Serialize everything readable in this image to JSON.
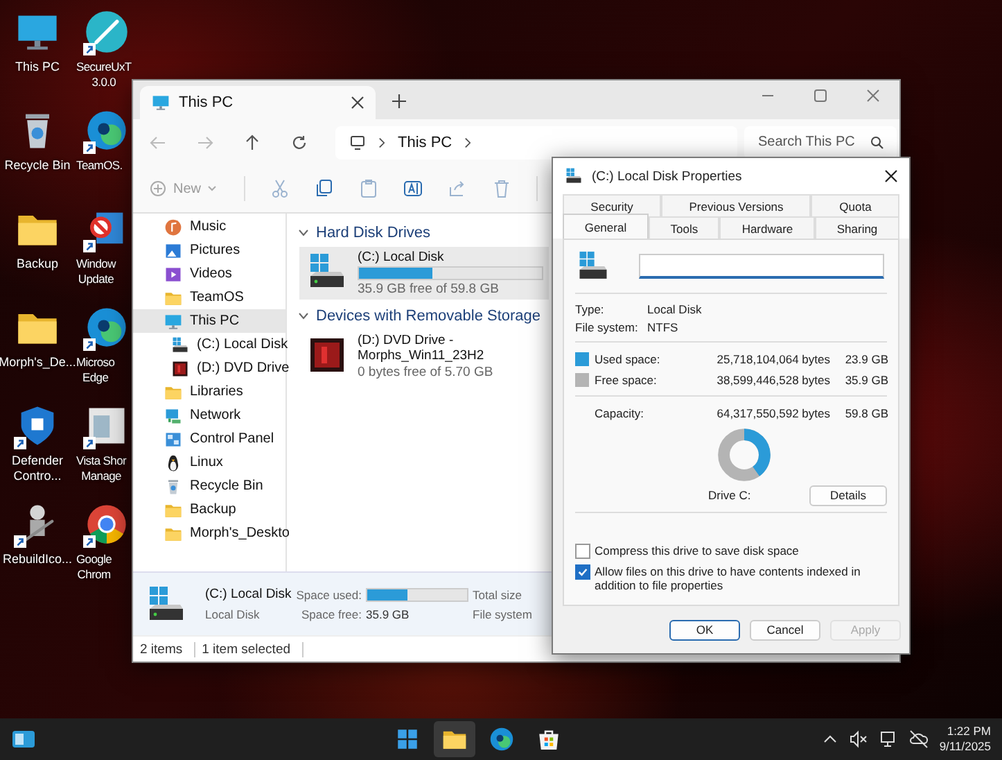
{
  "desktop": {
    "icons": [
      {
        "label": "This PC",
        "kind": "monitor",
        "shortcut": false
      },
      {
        "label": "SecureUxT\n3.0.0",
        "kind": "pen",
        "shortcut": true
      },
      {
        "label": "Recycle Bin",
        "kind": "bin",
        "shortcut": false
      },
      {
        "label": "TeamOS.",
        "kind": "edge",
        "shortcut": true
      },
      {
        "label": "Backup",
        "kind": "folder",
        "shortcut": false
      },
      {
        "label": "Window\nUpdate",
        "kind": "update",
        "shortcut": true
      },
      {
        "label": "Morph's_De...",
        "kind": "folder",
        "shortcut": false
      },
      {
        "label": "Microso\nEdge",
        "kind": "edge",
        "shortcut": true
      },
      {
        "label": "Defender\nContro...",
        "kind": "shield",
        "shortcut": true
      },
      {
        "label": "Vista Shor\nManage",
        "kind": "window",
        "shortcut": true
      },
      {
        "label": "RebuildIco...",
        "kind": "robot",
        "shortcut": true
      },
      {
        "label": "Google\nChrom",
        "kind": "chrome",
        "shortcut": true
      }
    ]
  },
  "explorer": {
    "tab": {
      "title": "This PC"
    },
    "address": {
      "path": "This PC"
    },
    "search": {
      "placeholder": "Search This PC"
    },
    "toolbar": {
      "new_label": "New"
    },
    "nav": [
      {
        "label": "Music",
        "kind": "music",
        "selected": false
      },
      {
        "label": "Pictures",
        "kind": "pictures",
        "selected": false
      },
      {
        "label": "Videos",
        "kind": "videos",
        "selected": false
      },
      {
        "label": "TeamOS",
        "kind": "folder",
        "selected": false
      },
      {
        "label": "This PC",
        "kind": "monitor",
        "selected": true,
        "children": [
          {
            "label": "(C:) Local Disk",
            "kind": "drive",
            "selected": false
          },
          {
            "label": "(D:) DVD Drive",
            "kind": "dvd",
            "selected": false
          }
        ]
      },
      {
        "label": "Libraries",
        "kind": "folder",
        "selected": false
      },
      {
        "label": "Network",
        "kind": "network",
        "selected": false
      },
      {
        "label": "Control Panel",
        "kind": "control",
        "selected": false
      },
      {
        "label": "Linux",
        "kind": "linux",
        "selected": false
      },
      {
        "label": "Recycle Bin",
        "kind": "bin",
        "selected": false
      },
      {
        "label": "Backup",
        "kind": "folder",
        "selected": false
      },
      {
        "label": "Morph's_Deskto",
        "kind": "folder",
        "selected": false
      }
    ],
    "groups": [
      {
        "title": "Hard Disk Drives",
        "drives": [
          {
            "name": "(C:) Local Disk",
            "kind": "hdd",
            "level": 0.4,
            "free": "35.9 GB free of 59.8 GB",
            "selected": true
          }
        ]
      },
      {
        "title": "Devices with Removable Storage",
        "drives": [
          {
            "name": "(D:) DVD Drive - Morphs_Win11_23H2",
            "kind": "dvd",
            "free": "0 bytes free of 5.70 GB",
            "selected": false
          }
        ]
      }
    ],
    "details": {
      "name": "(C:) Local Disk",
      "type": "Local Disk",
      "used_label": "Space used:",
      "level": 0.4,
      "free_label": "Space free:",
      "free": "35.9 GB",
      "total_label": "Total size",
      "fs_label": "File system"
    },
    "status": [
      "2 items",
      "1 item selected"
    ]
  },
  "dialog": {
    "title": "(C:) Local Disk Properties",
    "tab_rows": [
      [
        {
          "label": "Security",
          "selected": false
        },
        {
          "label": "Previous Versions",
          "selected": false
        },
        {
          "label": "Quota",
          "selected": false
        }
      ],
      [
        {
          "label": "General",
          "selected": true
        },
        {
          "label": "Tools",
          "selected": false
        },
        {
          "label": "Hardware",
          "selected": false
        },
        {
          "label": "Sharing",
          "selected": false
        }
      ]
    ],
    "props": [
      {
        "label": "Type:",
        "value": "Local Disk"
      },
      {
        "label": "File system:",
        "value": "NTFS"
      }
    ],
    "space": [
      {
        "label": "Used space:",
        "color": "#2b9bd8",
        "bytes": "25,718,104,064 bytes",
        "size": "23.9 GB"
      },
      {
        "label": "Free space:",
        "color": "#b4b4b4",
        "bytes": "38,599,446,528 bytes",
        "size": "35.9 GB"
      }
    ],
    "capacity": {
      "label": "Capacity:",
      "bytes": "64,317,550,592 bytes",
      "size": "59.8 GB"
    },
    "donut": {
      "level": 0.4,
      "label": "Drive C:"
    },
    "details_button": "Details",
    "options": [
      {
        "label": "Compress this drive to save disk space",
        "checked": false
      },
      {
        "label": "Allow files on this drive to have contents indexed in addition to file properties",
        "checked": true
      }
    ],
    "buttons": [
      {
        "label": "OK",
        "default": true,
        "disabled": false
      },
      {
        "label": "Cancel",
        "default": false,
        "disabled": false
      },
      {
        "label": "Apply",
        "default": false,
        "disabled": true
      }
    ]
  },
  "taskbar": {
    "apps": [
      {
        "kind": "start",
        "active": false
      },
      {
        "kind": "explorer",
        "active": true
      },
      {
        "kind": "edge",
        "active": false
      },
      {
        "kind": "store",
        "active": false
      }
    ],
    "time": "1:22 PM",
    "date": "9/11/2025"
  }
}
